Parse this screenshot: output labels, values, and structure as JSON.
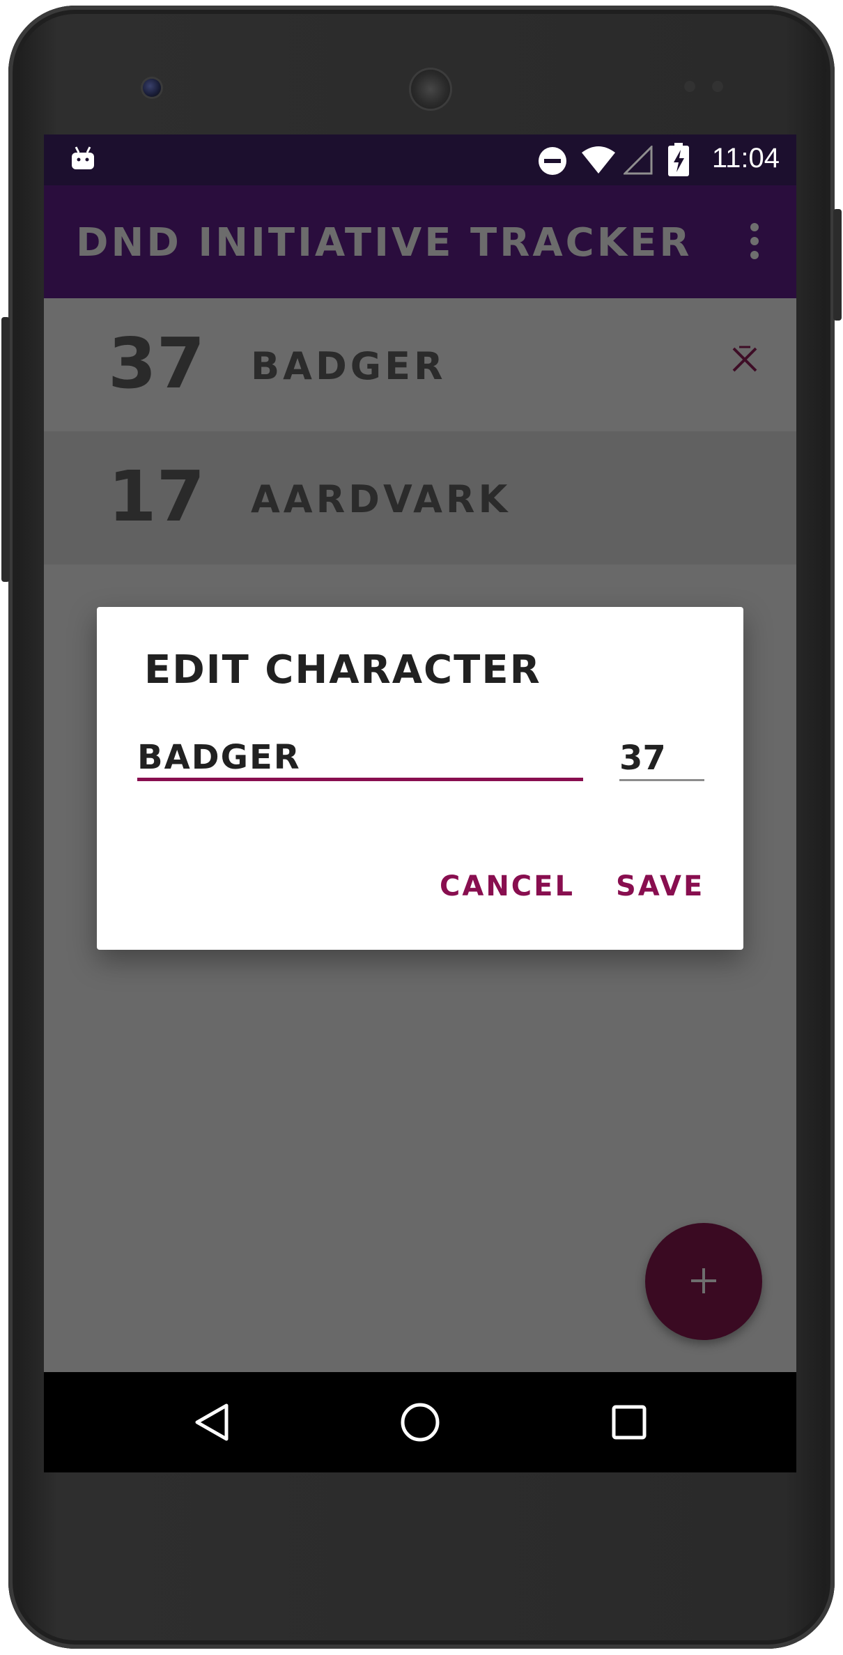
{
  "status_bar": {
    "time": "11:04",
    "icons": [
      "android-debug-icon",
      "do-not-disturb-icon",
      "wifi-icon",
      "cell-signal-icon",
      "battery-charging-icon"
    ]
  },
  "app_bar": {
    "title": "DND INITIATIVE TRACKER",
    "menu_icon": "overflow-menu-icon"
  },
  "characters": [
    {
      "initiative": "37",
      "name": "BADGER"
    },
    {
      "initiative": "17",
      "name": "AARDVARK"
    }
  ],
  "dialog": {
    "title": "EDIT CHARACTER",
    "name_value": "BADGER",
    "initiative_value": "37",
    "cancel_label": "CANCEL",
    "save_label": "SAVE"
  },
  "fab": {
    "icon": "plus-icon"
  },
  "nav": {
    "icons": [
      "back-icon",
      "home-icon",
      "recents-icon"
    ]
  },
  "colors": {
    "status_bar": "#1c0f2e",
    "app_bar": "#2a0d3d",
    "accent": "#880e4f",
    "fab": "#3a0a22",
    "scrim_bg": "#696969"
  }
}
